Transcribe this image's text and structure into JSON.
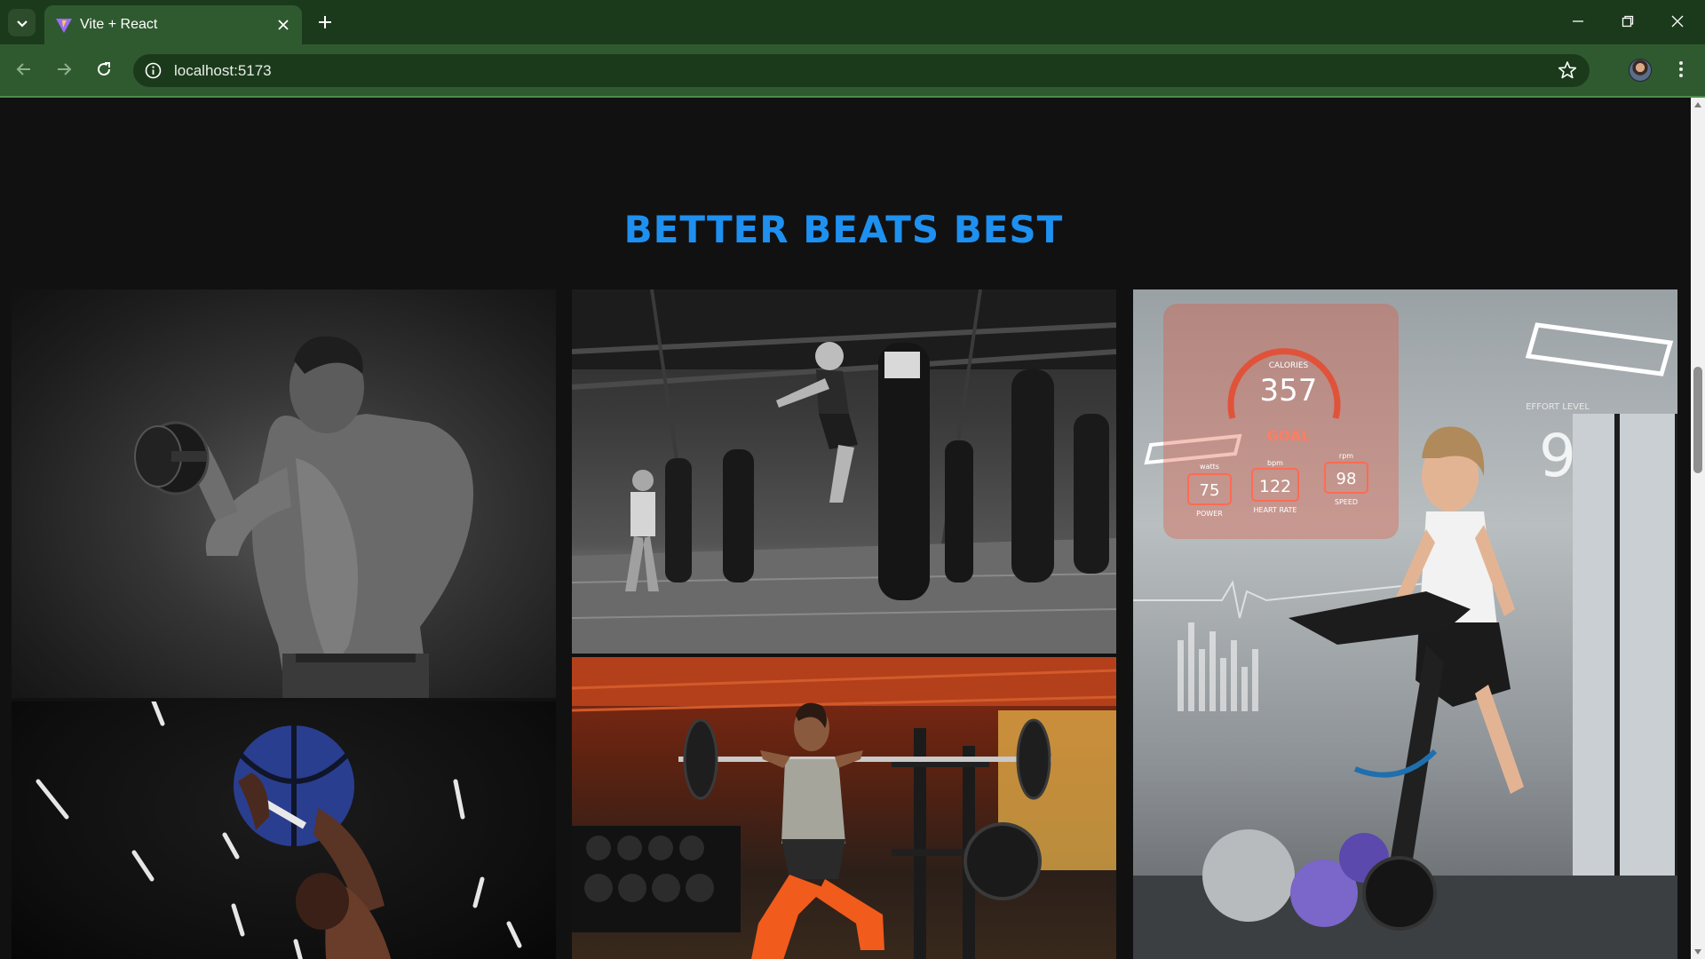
{
  "browser": {
    "tab_title": "Vite + React",
    "url": "localhost:5173"
  },
  "page": {
    "heading": "BETTER BEATS BEST",
    "accent_color": "#1e90f0",
    "gallery": [
      {
        "id": "bodybuilder-dumbbell-photo"
      },
      {
        "id": "boxing-gym-kick-photo"
      },
      {
        "id": "cycling-smart-dashboard-photo"
      },
      {
        "id": "medicine-ball-throw-photo"
      },
      {
        "id": "barbell-lunge-photo"
      }
    ],
    "overlay_labels": {
      "calories_label": "CALORIES",
      "calories_value": "357",
      "goal": "GOAL",
      "watts_label": "watts",
      "watts_value": "75",
      "power_label": "POWER",
      "bpm_label": "bpm",
      "bpm_value": "122",
      "heart_rate_label": "HEART RATE",
      "rpm_label": "rpm",
      "rpm_value": "98",
      "speed_label": "SPEED",
      "effort_label": "EFFORT LEVEL",
      "effort_value": "9"
    }
  },
  "icons": [
    "tab-search-icon",
    "vite-favicon-icon",
    "close-icon",
    "plus-icon",
    "minimize-icon",
    "restore-icon",
    "window-close-icon",
    "back-icon",
    "forward-icon",
    "reload-icon",
    "info-icon",
    "star-icon",
    "profile-avatar-icon",
    "kebab-menu-icon"
  ]
}
